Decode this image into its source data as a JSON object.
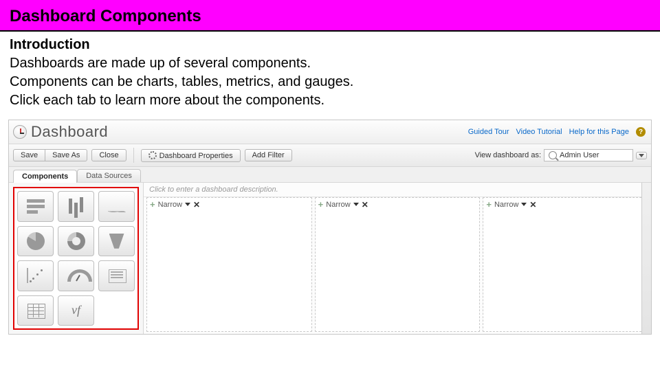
{
  "banner_title": "Dashboard Components",
  "intro": {
    "heading": "Introduction",
    "line1": "Dashboards are made up of several components.",
    "line2": "Components can be charts, tables, metrics, and gauges.",
    "line3": "Click each tab to learn more about the components."
  },
  "app": {
    "title": "Dashboard",
    "top_links": {
      "guided_tour": "Guided Tour",
      "video_tutorial": "Video Tutorial",
      "help": "Help for this Page"
    },
    "toolbar": {
      "save": "Save",
      "save_as": "Save As",
      "close": "Close",
      "properties": "Dashboard Properties",
      "add_filter": "Add Filter",
      "view_as_label": "View dashboard as:",
      "view_as_user": "Admin User"
    },
    "side_tabs": {
      "components": "Components",
      "data_sources": "Data Sources"
    },
    "palette": {
      "items": [
        "horizontal-bar-chart",
        "vertical-bar-chart",
        "line-chart",
        "pie-chart",
        "donut-chart",
        "funnel-chart",
        "scatter-chart",
        "gauge",
        "metric",
        "table",
        "visualforce-page"
      ]
    },
    "canvas": {
      "description_placeholder": "Click to enter a dashboard description.",
      "column_width_label": "Narrow"
    }
  }
}
